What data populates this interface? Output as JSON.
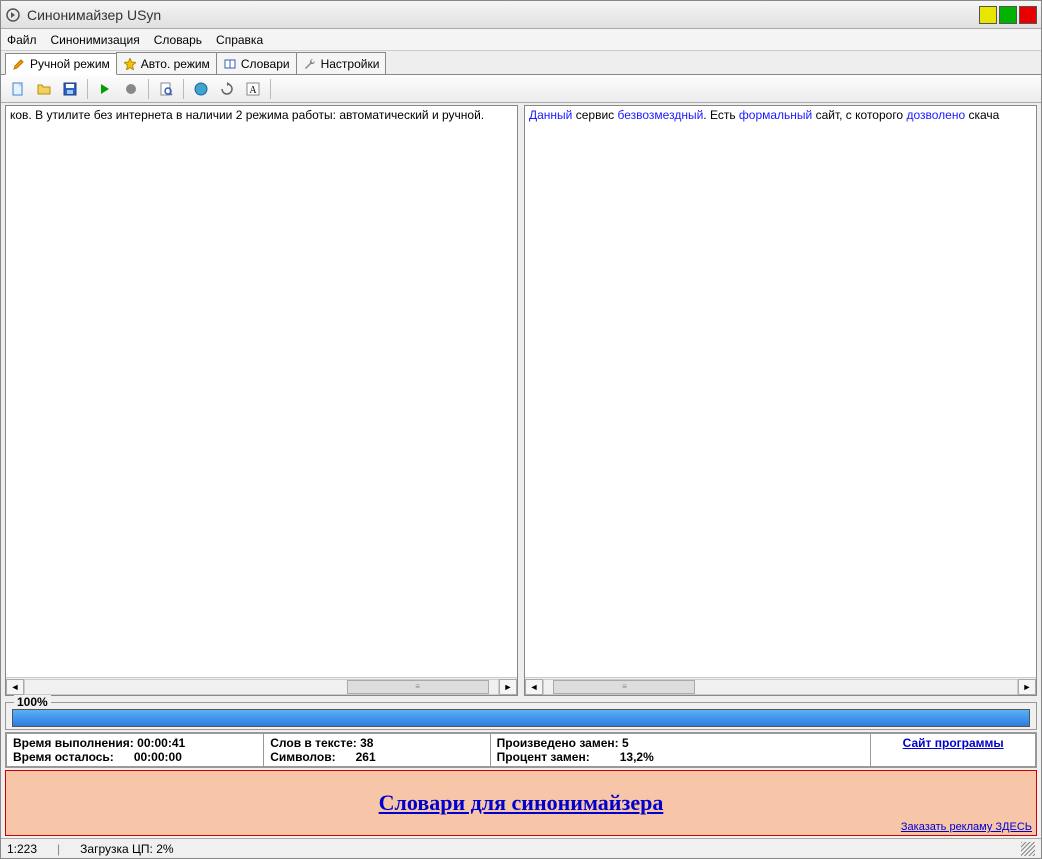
{
  "window": {
    "title": "Синонимайзер USyn"
  },
  "menu": {
    "file": "Файл",
    "synon": "Синонимизация",
    "dict": "Словарь",
    "help": "Справка"
  },
  "tabs": {
    "manual": "Ручной режим",
    "auto": "Авто. режим",
    "dicts": "Словари",
    "settings": "Настройки"
  },
  "toolbar_icons": {
    "new": "new-file-icon",
    "open": "open-folder-icon",
    "save": "save-icon",
    "go": "go-arrow-icon",
    "stop": "stop-icon",
    "find": "find-icon",
    "web": "globe-icon",
    "sync": "sync-icon",
    "font": "font-icon"
  },
  "left_text": "ков. В утилите без интернета в наличии 2 режима работы: автоматический и ручной.",
  "right_text": {
    "t1": "Данный",
    "t2": " сервис ",
    "t3": "безвозмездный",
    "t4": ". Есть ",
    "t5": "формальный",
    "t6": " сайт, с которого ",
    "t7": "дозволено",
    "t8": " скача"
  },
  "progress": {
    "label": "100%"
  },
  "stats": {
    "r1": {
      "a_label": "Время выполнения:",
      "a_val": "00:00:41",
      "b_label": "Слов в тексте:",
      "b_val": "38",
      "c_label": "Произведено замен:",
      "c_val": "5"
    },
    "r2": {
      "a_label": "Время осталось:",
      "a_val": "00:00:00",
      "b_label": "Символов:",
      "b_val": "261",
      "c_label": "Процент замен:",
      "c_val": "13,2%"
    },
    "site_link": "Сайт программы"
  },
  "banner": {
    "main": "Словари для синонимайзера",
    "ad": "Заказать рекламу ЗДЕСЬ"
  },
  "status": {
    "pos": "1:223",
    "cpu": "Загрузка ЦП: 2%"
  }
}
